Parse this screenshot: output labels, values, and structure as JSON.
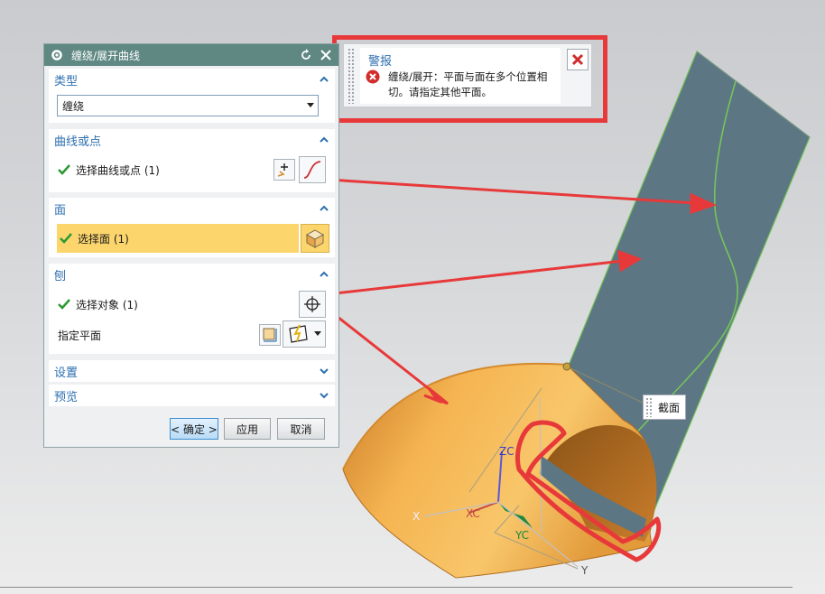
{
  "dialog": {
    "title": "缠绕/展开曲线",
    "sections": {
      "type": {
        "header": "类型",
        "value": "缠绕"
      },
      "curve": {
        "header": "曲线或点",
        "select_label": "选择曲线或点 (1)"
      },
      "face": {
        "header": "面",
        "select_label": "选择面 (1)"
      },
      "plane": {
        "header": "刨",
        "select_label": "选择对象 (1)",
        "specify_label": "指定平面"
      },
      "settings": {
        "header": "设置"
      },
      "preview": {
        "header": "预览"
      }
    },
    "buttons": {
      "ok": "< 确定 >",
      "apply": "应用",
      "cancel": "取消"
    }
  },
  "alert": {
    "title": "警报",
    "message": "缠绕/展开：平面与面在多个位置相切。请指定其他平面。"
  },
  "viewport": {
    "section_tag": "截面",
    "axes": {
      "zc": "ZC",
      "xc": "XC",
      "yc": "YC",
      "x": "X",
      "y": "Y"
    }
  },
  "colors": {
    "title_bar": "#5f8883",
    "accent_text": "#2d6fb0",
    "highlight_row": "#fcd56d",
    "annotation_red": "#e8393a",
    "plane_fill": "#5c7683",
    "surface_orange": "#f3a945"
  }
}
